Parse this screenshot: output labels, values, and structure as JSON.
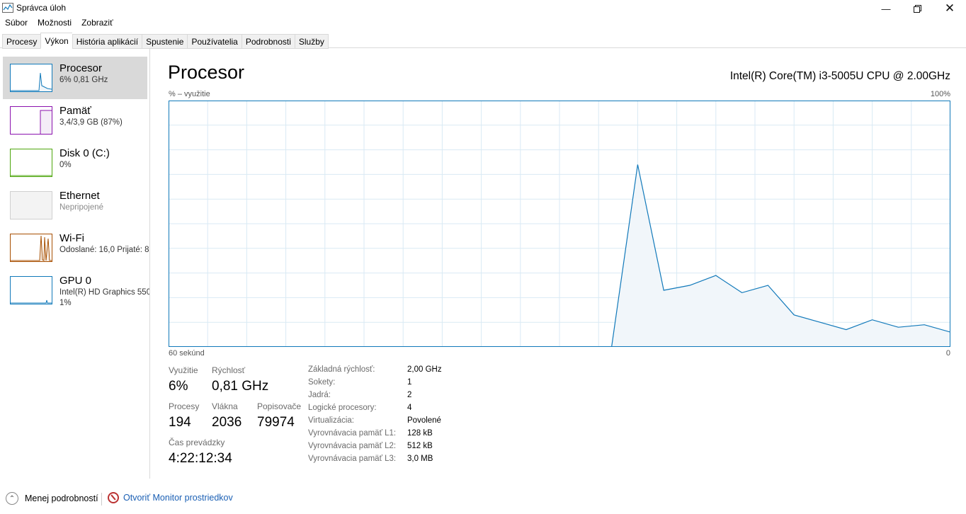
{
  "window": {
    "title": "Správca úloh"
  },
  "menu": [
    "Súbor",
    "Možnosti",
    "Zobraziť"
  ],
  "tabs": [
    "Procesy",
    "Výkon",
    "História aplikácií",
    "Spustenie",
    "Používatelia",
    "Podrobnosti",
    "Služby"
  ],
  "active_tab": "Výkon",
  "sidebar": [
    {
      "name": "Procesor",
      "sub": "6% 0,81 GHz",
      "color": "#1179ba",
      "selected": true
    },
    {
      "name": "Pamäť",
      "sub": "3,4/3,9 GB (87%)",
      "color": "#8b12ae"
    },
    {
      "name": "Disk 0 (C:)",
      "sub": "0%",
      "color": "#4da60c"
    },
    {
      "name": "Ethernet",
      "sub": "Nepripojené",
      "color": "#c8c8c8"
    },
    {
      "name": "Wi-Fi",
      "sub": "Odoslané: 16,0  Prijaté: 8",
      "color": "#a74f01"
    },
    {
      "name": "GPU 0",
      "sub": "Intel(R) HD Graphics 550",
      "sub2": "1%",
      "color": "#1179ba"
    }
  ],
  "main": {
    "title": "Procesor",
    "cpu_model": "Intel(R) Core(TM) i3-5005U CPU @ 2.00GHz",
    "y_label": "% – využitie",
    "y_max_label": "100%",
    "x_left_label": "60 sekúnd",
    "x_right_label": "0"
  },
  "stats": {
    "utilization_label": "Využitie",
    "utilization": "6%",
    "speed_label": "Rýchlosť",
    "speed": "0,81 GHz",
    "processes_label": "Procesy",
    "processes": "194",
    "threads_label": "Vlákna",
    "threads": "2036",
    "handles_label": "Popisovače",
    "handles": "79974",
    "uptime_label": "Čas prevádzky",
    "uptime": "4:22:12:34"
  },
  "specs": [
    {
      "key": "Základná rýchlosť:",
      "value": "2,00 GHz"
    },
    {
      "key": "Sokety:",
      "value": "1"
    },
    {
      "key": "Jadrá:",
      "value": "2"
    },
    {
      "key": "Logické procesory:",
      "value": "4"
    },
    {
      "key": "Virtualizácia:",
      "value": "Povolené"
    },
    {
      "key": "Vyrovnávacia pamäť L1:",
      "value": "128 kB"
    },
    {
      "key": "Vyrovnávacia pamäť L2:",
      "value": "512 kB"
    },
    {
      "key": "Vyrovnávacia pamäť L3:",
      "value": "3,0 MB"
    }
  ],
  "footer": {
    "less_details": "Menej podrobností",
    "resource_monitor": "Otvoriť Monitor prostriedkov"
  },
  "chart_data": {
    "type": "area",
    "color": "#1179ba",
    "fill": "#f1f6fa",
    "grid": true,
    "ylim": [
      0,
      100
    ],
    "xlim": [
      60,
      0
    ],
    "x": [
      60,
      58,
      56,
      54,
      52,
      50,
      48,
      46,
      44,
      42,
      40,
      38,
      36,
      34,
      32,
      30,
      28,
      26,
      24,
      22,
      20,
      18,
      16,
      14,
      12,
      10,
      8,
      6,
      4,
      2,
      0
    ],
    "y": [
      0,
      0,
      0,
      0,
      0,
      0,
      0,
      0,
      0,
      0,
      0,
      0,
      0,
      0,
      0,
      0,
      0,
      0,
      74,
      23,
      25,
      29,
      22,
      25,
      13,
      10,
      7,
      11,
      8,
      9,
      6
    ]
  }
}
